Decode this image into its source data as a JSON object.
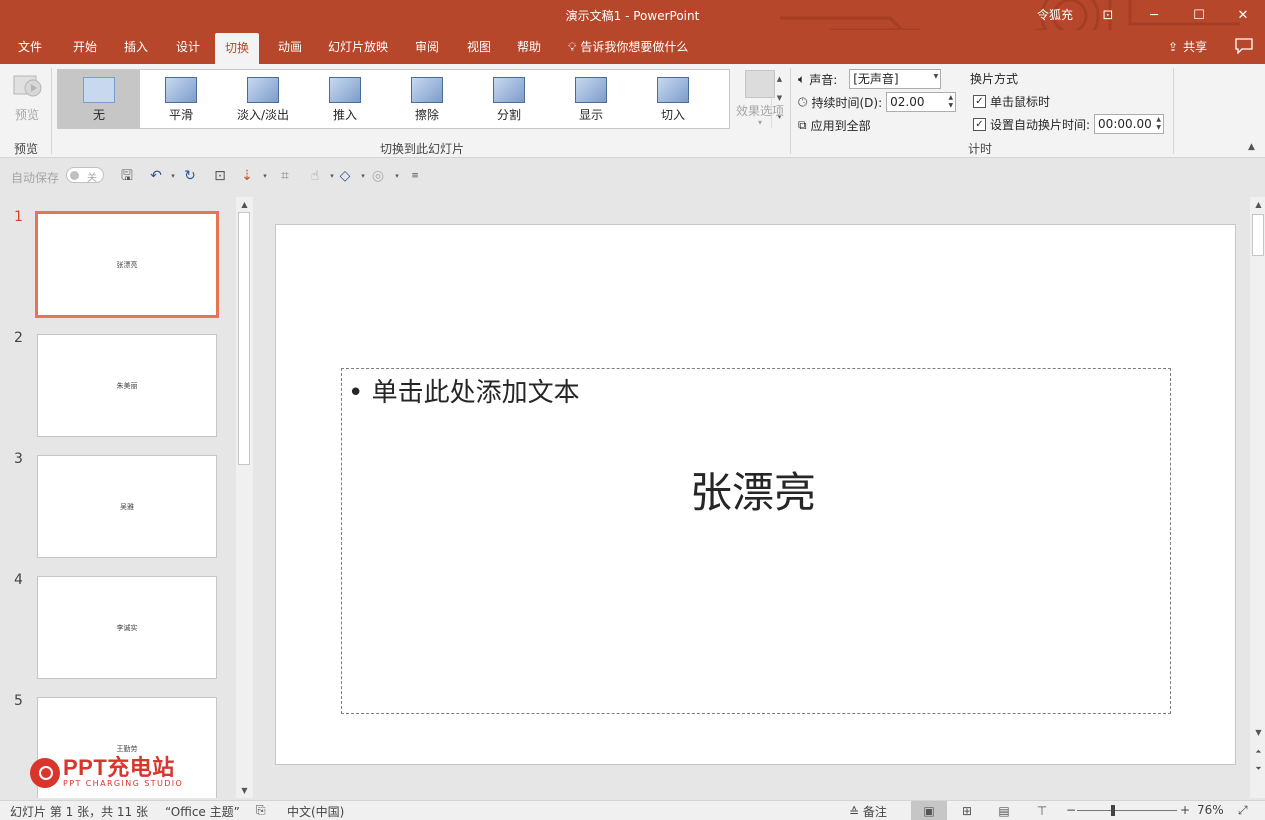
{
  "window": {
    "title": "演示文稿1  -  PowerPoint",
    "user": "令狐充"
  },
  "tabs": [
    {
      "label": "文件"
    },
    {
      "label": "开始"
    },
    {
      "label": "插入"
    },
    {
      "label": "设计"
    },
    {
      "label": "切换"
    },
    {
      "label": "动画"
    },
    {
      "label": "幻灯片放映"
    },
    {
      "label": "审阅"
    },
    {
      "label": "视图"
    },
    {
      "label": "帮助"
    }
  ],
  "tellme": "告诉我你想要做什么",
  "share": "共享",
  "ribbon": {
    "preview": {
      "label": "预览",
      "group": "预览"
    },
    "transitions": [
      {
        "label": "无"
      },
      {
        "label": "平滑"
      },
      {
        "label": "淡入/淡出"
      },
      {
        "label": "推入"
      },
      {
        "label": "擦除"
      },
      {
        "label": "分割"
      },
      {
        "label": "显示"
      },
      {
        "label": "切入"
      }
    ],
    "transitions_group": "切换到此幻灯片",
    "effect_options": "效果选项",
    "timing": {
      "sound_label": "声音:",
      "sound_value": "[无声音]",
      "duration_label": "持续时间(D):",
      "duration_value": "02.00",
      "apply_all": "应用到全部",
      "advance_title": "换片方式",
      "on_click": "单击鼠标时",
      "after_label": "设置自动换片时间:",
      "after_value": "00:00.00",
      "group": "计时"
    }
  },
  "qat": {
    "autosave": "自动保存",
    "toggle": "关"
  },
  "slides": [
    {
      "num": "1",
      "title": "张漂亮"
    },
    {
      "num": "2",
      "title": "朱美丽"
    },
    {
      "num": "3",
      "title": "吴雅"
    },
    {
      "num": "4",
      "title": "李诚实"
    },
    {
      "num": "5",
      "title": "王勤劳"
    }
  ],
  "current_slide": {
    "body_placeholder": "• 单击此处添加文本",
    "title": "张漂亮"
  },
  "watermark": {
    "name": "PPT充电站",
    "sub": "PPT CHARGING STUDIO"
  },
  "status": {
    "slide_info": "幻灯片 第 1 张，共 11 张",
    "theme": "“Office 主题”",
    "language": "中文(中国)",
    "notes": "备注",
    "zoom": "76%"
  }
}
